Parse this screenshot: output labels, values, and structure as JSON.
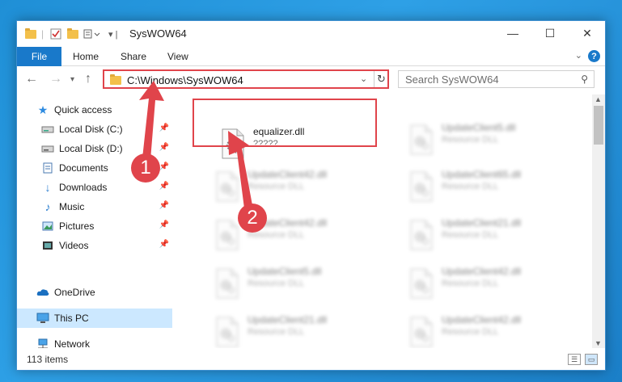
{
  "window": {
    "title": "SysWOW64",
    "minimize_label": "—",
    "maximize_label": "☐",
    "close_label": "✕"
  },
  "ribbon": {
    "tabs": [
      "File",
      "Home",
      "Share",
      "View"
    ],
    "help_label": "?"
  },
  "address": {
    "path": "C:\\Windows\\SysWOW64",
    "refresh_icon": "↻"
  },
  "search": {
    "placeholder": "Search SysWOW64"
  },
  "sidebar": {
    "items": [
      {
        "label": "Quick access",
        "icon": "star-icon",
        "pinned": false
      },
      {
        "label": "Local Disk (C:)",
        "icon": "drive-icon",
        "pinned": true
      },
      {
        "label": "Local Disk (D:)",
        "icon": "drive-icon",
        "pinned": true
      },
      {
        "label": "Documents",
        "icon": "documents-icon",
        "pinned": true
      },
      {
        "label": "Downloads",
        "icon": "download-icon",
        "pinned": true
      },
      {
        "label": "Music",
        "icon": "music-icon",
        "pinned": true
      },
      {
        "label": "Pictures",
        "icon": "pictures-icon",
        "pinned": true
      },
      {
        "label": "Videos",
        "icon": "videos-icon",
        "pinned": true
      },
      {
        "label": "OneDrive",
        "icon": "cloud-icon",
        "pinned": false
      },
      {
        "label": "This PC",
        "icon": "pc-icon",
        "pinned": false,
        "selected": true
      },
      {
        "label": "Network",
        "icon": "network-icon",
        "pinned": false
      }
    ]
  },
  "files": [
    {
      "name": "equalizer.dll",
      "type": "?????",
      "highlighted": true,
      "blurred": false
    },
    {
      "name": "UpdateClient5.dll",
      "type": "Resource DLL",
      "blurred": true
    },
    {
      "name": "UpdateClient42.dll",
      "type": "Resource DLL",
      "blurred": true
    },
    {
      "name": "UpdateClient65.dll",
      "type": "Resource DLL",
      "blurred": true
    },
    {
      "name": "UpdateClient42.dll",
      "type": "Resource DLL",
      "blurred": true
    },
    {
      "name": "UpdateClient21.dll",
      "type": "Resource DLL",
      "blurred": true
    },
    {
      "name": "UpdateClient5.dll",
      "type": "Resource DLL",
      "blurred": true
    },
    {
      "name": "UpdateClient42.dll",
      "type": "Resource DLL",
      "blurred": true
    },
    {
      "name": "UpdateClient21.dll",
      "type": "Resource DLL",
      "blurred": true
    },
    {
      "name": "UpdateClient42.dll",
      "type": "Resource DLL",
      "blurred": true
    }
  ],
  "status": {
    "item_count": "113 items"
  },
  "annotations": {
    "step1": "1",
    "step2": "2",
    "color": "#e0444b"
  },
  "colors": {
    "accent": "#1979ca",
    "selection": "#cce8ff",
    "highlight_red": "#e0444b",
    "folder": "#f3c04a"
  }
}
